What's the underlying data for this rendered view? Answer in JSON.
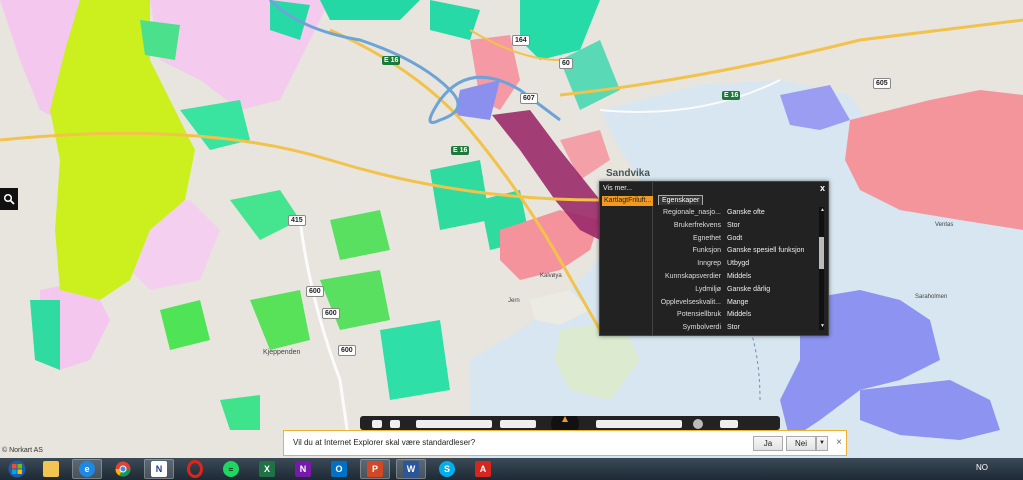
{
  "map": {
    "labels": {
      "sandvika": "Sandvika",
      "ventas": "Ventas",
      "sarholmen": "Saraholmen",
      "kjeppenden": "Kjeppenden",
      "karlsu": "Kalvøya",
      "jern": "Jern"
    },
    "shields": {
      "e16_a": "E 16",
      "e16_b": "E 16",
      "e16_c": "E 16",
      "r164": "164",
      "r607": "607",
      "r605": "605",
      "r415": "415",
      "r600_a": "600",
      "r600_b": "600",
      "r600_c": "600",
      "r60": "60"
    }
  },
  "popup": {
    "vis_mer": "Vis mer...",
    "layer": "KartlagtFriluft...",
    "close": "x",
    "tab": "Egenskaper",
    "properties": [
      {
        "key": "Regionale_nasjo...",
        "value": "Ganske ofte"
      },
      {
        "key": "Brukerfrekvens",
        "value": "Stor"
      },
      {
        "key": "Egnethet",
        "value": "Godt"
      },
      {
        "key": "Funksjon",
        "value": "Ganske spesiell funksjon"
      },
      {
        "key": "Inngrep",
        "value": "Utbygd"
      },
      {
        "key": "Kunnskapsverdier",
        "value": "Middels"
      },
      {
        "key": "Lydmiljø",
        "value": "Ganske dårlig"
      },
      {
        "key": "Opplevelseskvalit...",
        "value": "Mange"
      },
      {
        "key": "Potensiellbruk",
        "value": "Middels"
      },
      {
        "key": "Symbolverdi",
        "value": "Stor"
      }
    ]
  },
  "ie_bar": {
    "message": "Vil du at Internet Explorer skal være standardleser?",
    "yes": "Ja",
    "no": "Nei",
    "close": "×"
  },
  "copyright": "© Norkart AS",
  "taskbar": {
    "language": "NO",
    "icons": [
      "windows-start",
      "file-explorer",
      "internet-explorer",
      "chrome",
      "norkart-app",
      "opera",
      "spotify",
      "excel",
      "onenote",
      "outlook",
      "powerpoint",
      "word",
      "skype",
      "acrobat"
    ]
  }
}
